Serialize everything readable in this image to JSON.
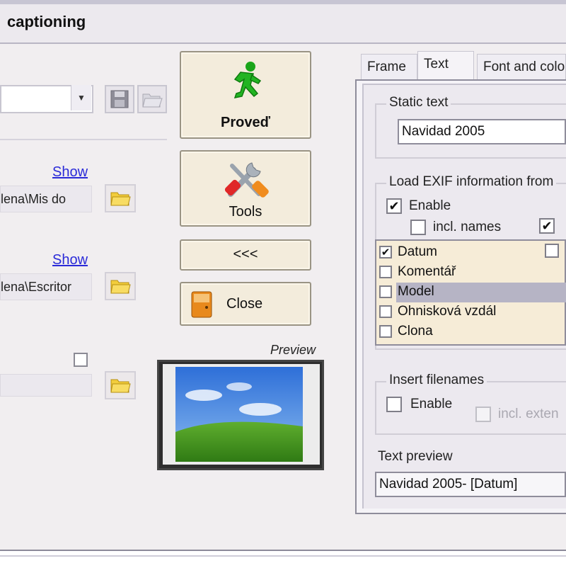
{
  "window": {
    "title": "captioning"
  },
  "left_panel": {
    "show_link_1": "Show",
    "path_1": "elena\\Mis do",
    "show_link_2": "Show",
    "path_2": "elena\\Escritor"
  },
  "buttons": {
    "run_label": "Proveď",
    "tools_label": "Tools",
    "back_label": "<<<",
    "close_label": "Close"
  },
  "preview": {
    "label": "Preview"
  },
  "tabs": [
    {
      "label": "Frame"
    },
    {
      "label": "Text"
    },
    {
      "label": "Font and colo"
    }
  ],
  "text_tab": {
    "static_text": {
      "group_label": "Static text",
      "value": "Navidad 2005"
    },
    "exif": {
      "group_label": "Load EXIF information from",
      "enable_label": "Enable",
      "enable_checked": true,
      "incl_names_label": "incl. names",
      "incl_names_checked": false,
      "second_option_checked": true,
      "items": [
        {
          "label": "Datum",
          "checked": true,
          "selected": false
        },
        {
          "label": "Komentář",
          "checked": false,
          "selected": false
        },
        {
          "label": "Model",
          "checked": false,
          "selected": true
        },
        {
          "label": "Ohnisková vzdál",
          "checked": false,
          "selected": false
        },
        {
          "label": "Clona",
          "checked": false,
          "selected": false
        }
      ]
    },
    "insert_filenames": {
      "group_label": "Insert filenames",
      "enable_label": "Enable",
      "enable_checked": false,
      "incl_ext_label": "incl. exten"
    },
    "text_preview": {
      "label": "Text preview",
      "value": "Navidad 2005- [Datum]"
    }
  },
  "colors": {
    "window_bg": "#f1eef0",
    "button_face": "#f3ecdc",
    "list_bg": "#f6ecd7",
    "link": "#2a2ad8",
    "selection": "#b6b4c5"
  },
  "icons": [
    "running-man-icon",
    "tools-icon",
    "close-door-icon",
    "floppy-disk-icon",
    "open-folder-icon",
    "folder-icon"
  ]
}
